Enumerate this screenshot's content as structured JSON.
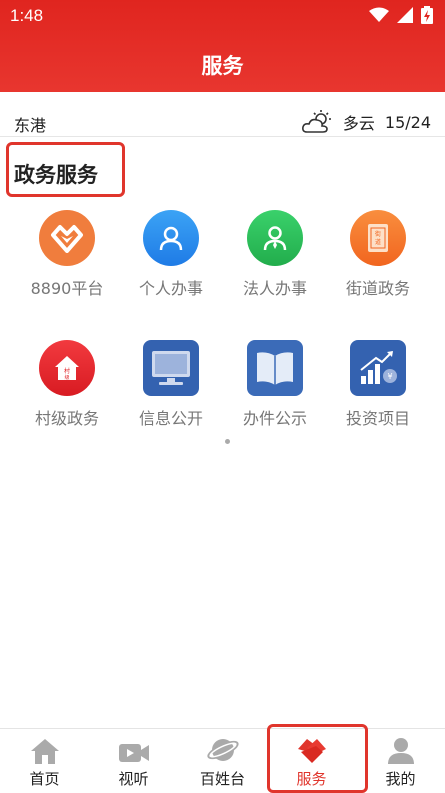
{
  "status_bar": {
    "time": "1:48"
  },
  "header": {
    "title": "服务"
  },
  "weather": {
    "location": "东港",
    "condition": "多云",
    "temp_range": "15/24"
  },
  "section": {
    "title": "政务服务"
  },
  "services": [
    {
      "label": "8890平台",
      "icon": "diamond-heart-icon",
      "color": "#f07d3d"
    },
    {
      "label": "个人办事",
      "icon": "person-icon",
      "color": "#2a8ef0"
    },
    {
      "label": "法人办事",
      "icon": "legal-person-icon",
      "color": "#2fbf5c"
    },
    {
      "label": "街道政务",
      "icon": "street-icon",
      "color": "#f5792a"
    },
    {
      "label": "村级政务",
      "icon": "village-house-icon",
      "color": "#e8262f"
    },
    {
      "label": "信息公开",
      "icon": "monitor-icon",
      "color": "#3462b0"
    },
    {
      "label": "办件公示",
      "icon": "open-book-icon",
      "color": "#3b6bb8"
    },
    {
      "label": "投资项目",
      "icon": "investment-chart-icon",
      "color": "#3462b0"
    }
  ],
  "bottom_nav": [
    {
      "label": "首页",
      "icon": "home-icon"
    },
    {
      "label": "视听",
      "icon": "video-icon"
    },
    {
      "label": "百姓台",
      "icon": "planet-icon"
    },
    {
      "label": "服务",
      "icon": "handshake-icon",
      "active": true
    },
    {
      "label": "我的",
      "icon": "user-icon"
    }
  ],
  "colors": {
    "brand": "#e0251f",
    "highlight": "#e0352c",
    "label": "#777777"
  }
}
